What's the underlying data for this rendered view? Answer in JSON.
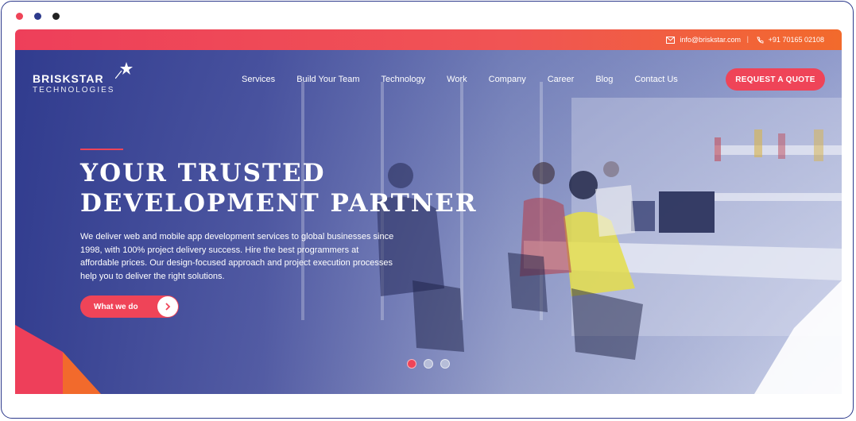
{
  "topbar": {
    "email": "info@briskstar.com",
    "separator": "|",
    "phone": "+91 70165 02108"
  },
  "logo": {
    "name": "BRISKSTAR",
    "subtitle": "TECHNOLOGIES"
  },
  "nav": {
    "items": [
      "Services",
      "Build Your Team",
      "Technology",
      "Work",
      "Company",
      "Career",
      "Blog",
      "Contact Us"
    ],
    "quote_button": "REQUEST A QUOTE"
  },
  "hero": {
    "headline_line1": "YOUR TRUSTED",
    "headline_line2": "DEVELOPMENT PARTNER",
    "description": "We deliver web and mobile app development services to global businesses since 1998, with 100% project delivery success. Hire the best programmers at affordable prices. Our design-focused approach and project execution processes help you to deliver the right solutions.",
    "cta_label": "What we do",
    "slides_total": 3,
    "active_slide": 1
  },
  "colors": {
    "accent": "#ef4458",
    "brand_blue": "#2d3a8c",
    "topbar_end": "#f26a2c"
  }
}
